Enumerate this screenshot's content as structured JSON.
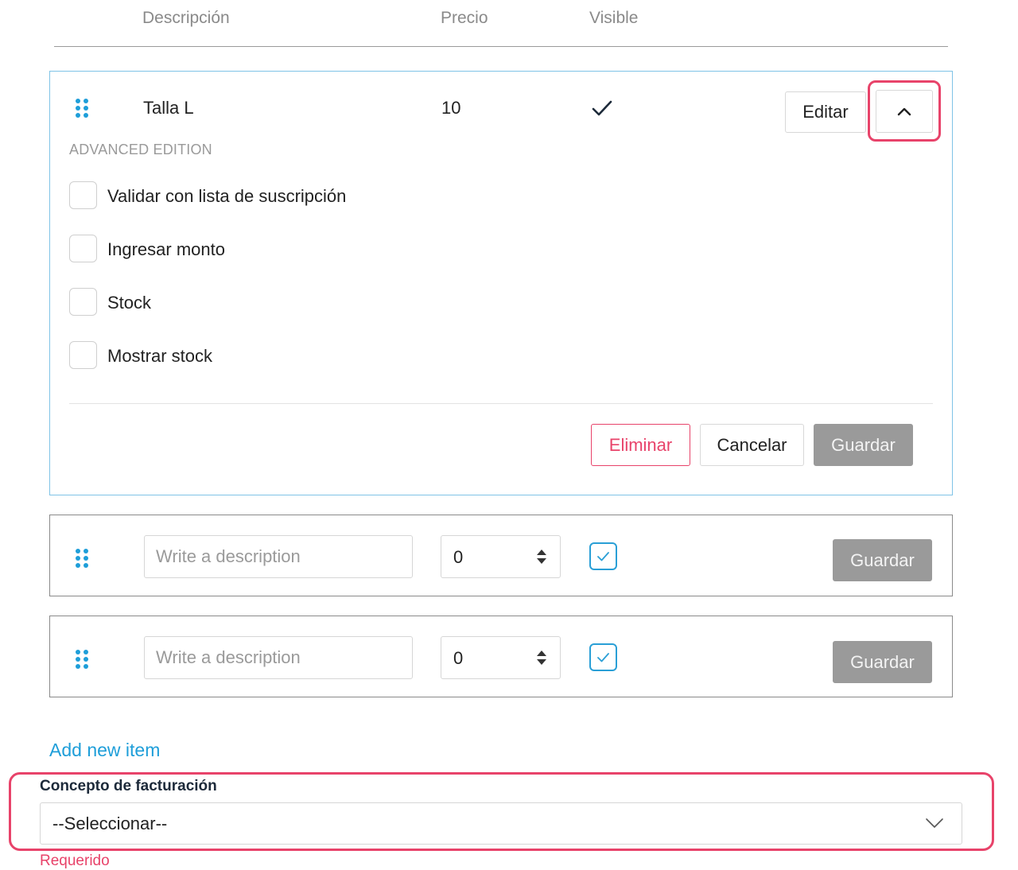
{
  "table_header": {
    "description": "Descripción",
    "price": "Precio",
    "visible": "Visible"
  },
  "expanded_item": {
    "description": "Talla L",
    "price": "10",
    "visible": true,
    "edit_label": "Editar",
    "collapse_icon": "chevron-up-icon",
    "advanced_title": "ADVANCED EDITION",
    "options": [
      {
        "label": "Validar con lista de suscripción",
        "checked": false
      },
      {
        "label": "Ingresar monto",
        "checked": false
      },
      {
        "label": "Stock",
        "checked": false
      },
      {
        "label": "Mostrar stock",
        "checked": false
      }
    ],
    "delete_label": "Eliminar",
    "cancel_label": "Cancelar",
    "save_label": "Guardar"
  },
  "new_items": [
    {
      "placeholder": "Write a description",
      "price": "0",
      "visible": true,
      "save_label": "Guardar"
    },
    {
      "placeholder": "Write a description",
      "price": "0",
      "visible": true,
      "save_label": "Guardar"
    }
  ],
  "add_item_label": "Add new item",
  "billing": {
    "label": "Concepto de facturación",
    "selected": "--Seleccionar--",
    "error": "Requerido"
  },
  "colors": {
    "accent": "#1e9ed9",
    "danger": "#e8436a",
    "disabled_button": "#9a9a9a"
  }
}
